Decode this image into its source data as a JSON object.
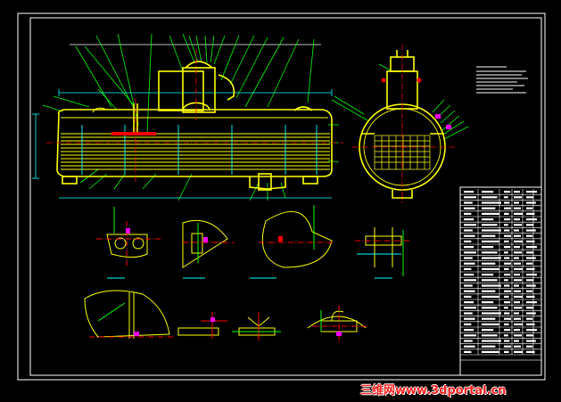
{
  "drawing": {
    "background_color": "#000000",
    "colors": {
      "frame": "#ffffff",
      "outline": "#ffff00",
      "centerline": "#ff0000",
      "leader": "#00ff00",
      "dimension": "#00ffff",
      "accent": "#ff00ff"
    },
    "views": [
      {
        "name": "elevation-view",
        "depicts": "horizontal vessel with tube bundle, elevation"
      },
      {
        "name": "end-section-view",
        "depicts": "circular cross-section with tube sheet"
      },
      {
        "name": "detail-views",
        "depicts": "nine enlarged construction details"
      }
    ],
    "table": {
      "rows": 30,
      "columns": 6
    }
  },
  "watermark": {
    "text": "三维网www.3dportal.cn",
    "color": "#ff1e1e",
    "outline_color": "#ffffff"
  }
}
